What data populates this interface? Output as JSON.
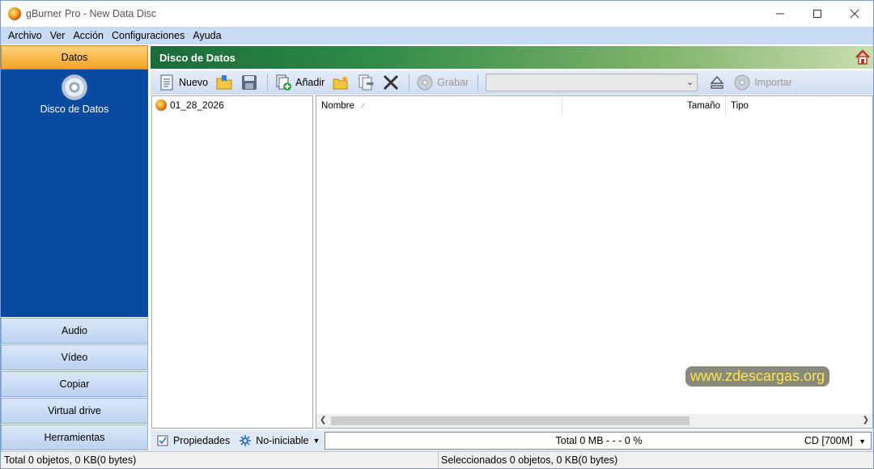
{
  "window": {
    "title": "gBurner Pro - New Data Disc"
  },
  "menu": [
    "Archivo",
    "Ver",
    "Acción",
    "Configuraciones",
    "Ayuda"
  ],
  "sidebar": {
    "active": "Datos",
    "active_item_label": "Disco de Datos",
    "buttons": [
      "Audio",
      "Vídeo",
      "Copiar",
      "Virtual drive",
      "Herramientas"
    ]
  },
  "main": {
    "header_title": "Disco de Datos",
    "toolbar": {
      "new_label": "Nuevo",
      "add_label": "Añadir",
      "burn_label": "Grabar",
      "import_label": "Importar",
      "drive_value": ""
    },
    "tree": {
      "root": "01_28_2026"
    },
    "columns": {
      "name": "Nombre",
      "size": "Tamaño",
      "type": "Tipo"
    },
    "watermark": "www.zdescargas.org"
  },
  "bottom": {
    "properties_label": "Propiedades",
    "boot_label": "No-iniciable",
    "capacity_text": "Total 0 MB  - - -  0 %",
    "media": "CD [700M]"
  },
  "status": {
    "left": "Total 0 objetos, 0 KB(0 bytes)",
    "right": "Seleccionados 0 objetos, 0 KB(0 bytes)"
  }
}
